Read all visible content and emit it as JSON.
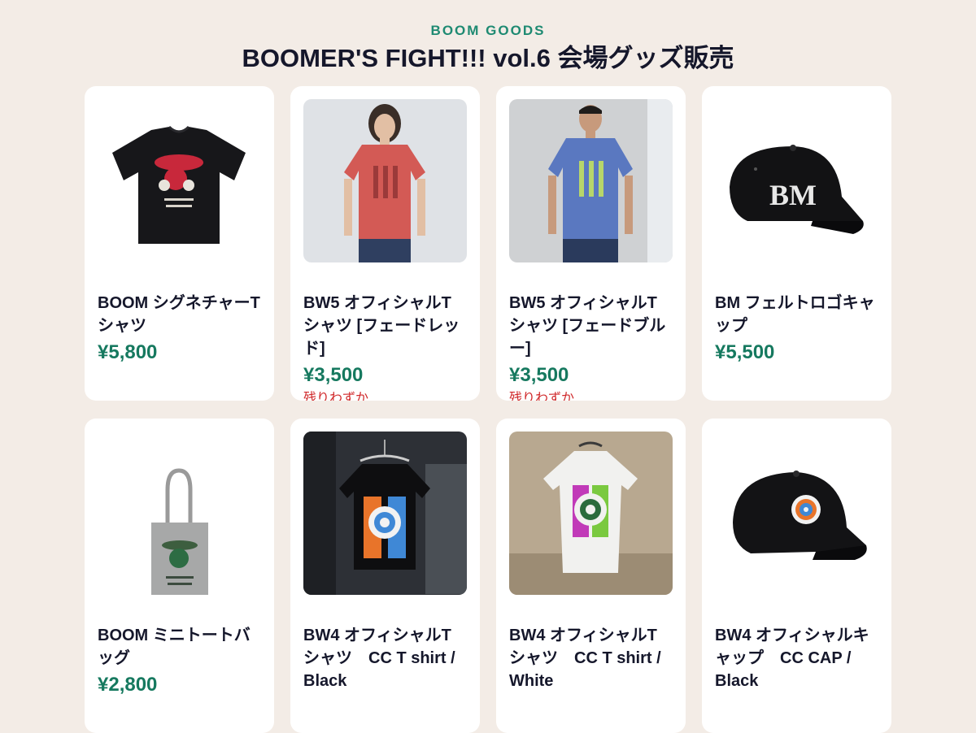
{
  "header": {
    "eyebrow": "BOOM GOODS",
    "title": "BOOMER'S FIGHT!!! vol.6 会場グッズ販売"
  },
  "colors": {
    "accent": "#16795f",
    "lowStock": "#d0282a",
    "background": "#f3ece6"
  },
  "products": [
    {
      "name": "BOOM シグネチャーTシャツ",
      "price": "¥5,800",
      "stock": "",
      "image": "black-tshirt-image"
    },
    {
      "name": "BW5 オフィシャルTシャツ [フェードレッド]",
      "price": "¥3,500",
      "stock": "残りわずか",
      "image": "model-red-tshirt-image"
    },
    {
      "name": "BW5 オフィシャルTシャツ [フェードブルー]",
      "price": "¥3,500",
      "stock": "残りわずか",
      "image": "model-blue-tshirt-image"
    },
    {
      "name": "BM フェルトロゴキャップ",
      "price": "¥5,500",
      "stock": "",
      "image": "black-cap-image"
    },
    {
      "name": "BOOM ミニトートバッグ",
      "price": "¥2,800",
      "stock": "",
      "image": "tote-bag-image"
    },
    {
      "name": "BW4 オフィシャルTシャツ　CC T shirt / Black",
      "price": "",
      "stock": "",
      "image": "hanging-black-tshirt-image"
    },
    {
      "name": "BW4 オフィシャルTシャツ　CC T shirt / White",
      "price": "",
      "stock": "",
      "image": "white-tshirt-image"
    },
    {
      "name": "BW4 オフィシャルキャップ　CC CAP / Black",
      "price": "",
      "stock": "",
      "image": "cc-cap-image"
    }
  ]
}
